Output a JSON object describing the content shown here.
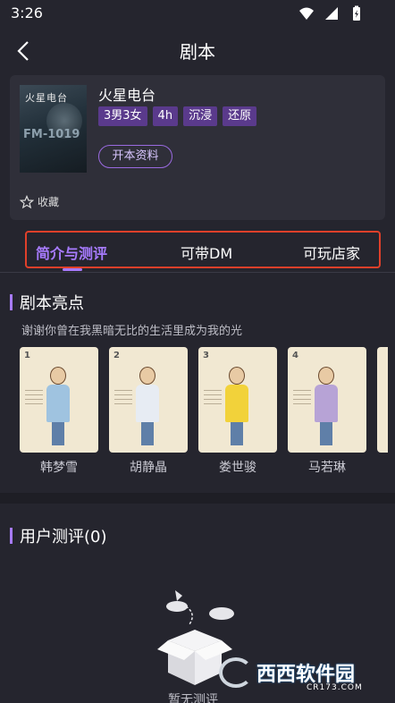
{
  "status": {
    "time": "3:26"
  },
  "nav": {
    "title": "剧本"
  },
  "script": {
    "name": "火星电台",
    "poster_title": "火星电台",
    "poster_fm": "FM-1019",
    "tags": [
      "3男3女",
      "4h",
      "沉浸",
      "还原"
    ],
    "open_button": "开本资料",
    "favorite_label": "收藏"
  },
  "tabs": [
    {
      "label": "简介与测评",
      "active": true
    },
    {
      "label": "可带DM",
      "active": false
    },
    {
      "label": "可玩店家",
      "active": false
    }
  ],
  "highlights": {
    "title": "剧本亮点",
    "tagline": "谢谢你曾在我黑暗无比的生活里成为我的光",
    "characters": [
      {
        "name": "韩梦雪",
        "outfit": "#9fc3e0"
      },
      {
        "name": "胡静晶",
        "outfit": "#e7ecf3"
      },
      {
        "name": "娄世骏",
        "outfit": "#f2d23a"
      },
      {
        "name": "马若琳",
        "outfit": "#b7a3d6"
      }
    ]
  },
  "reviews": {
    "title": "用户测评(0)",
    "empty_text": "暂无测评"
  },
  "watermark": {
    "brand": "西西软件园",
    "sub": "CR173.COM"
  },
  "colors": {
    "accent": "#a77bff",
    "tag_bg": "#5a3a8c",
    "highlight_border": "#e0402a"
  }
}
